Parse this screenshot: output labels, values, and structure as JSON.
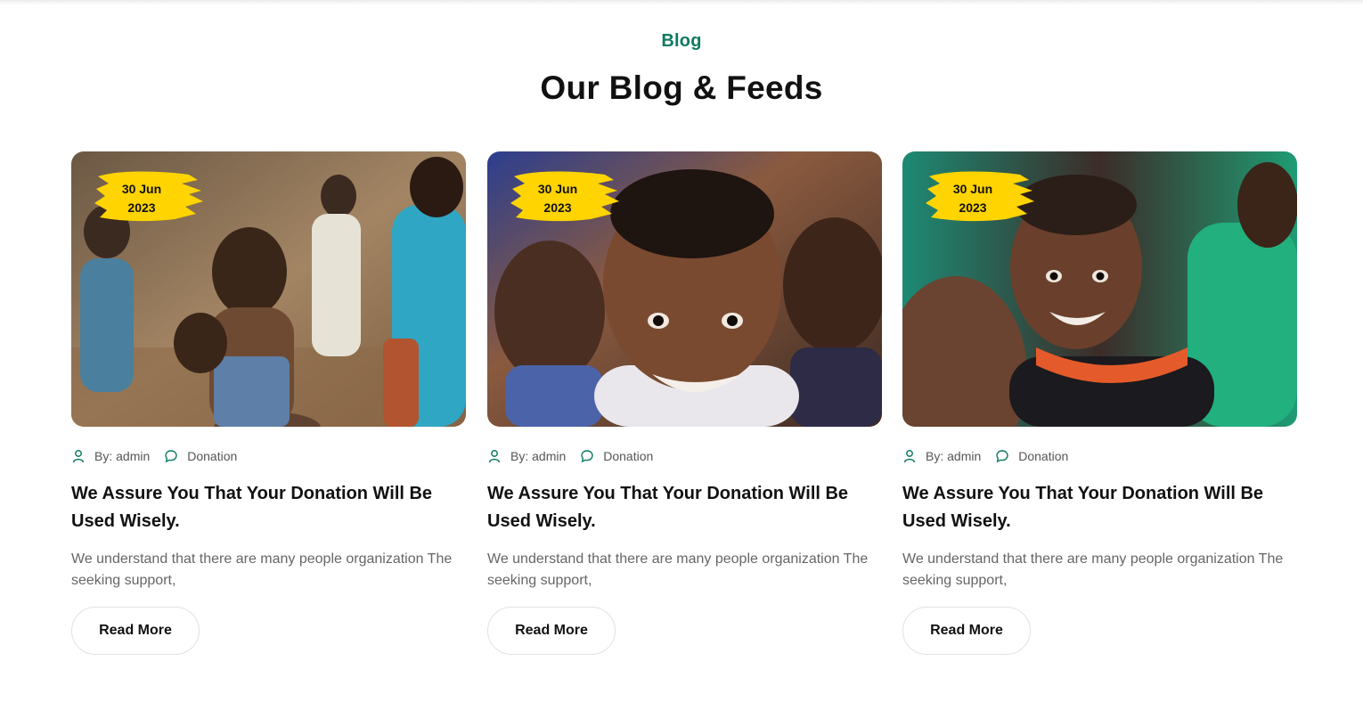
{
  "section": {
    "eyebrow": "Blog",
    "title": "Our Blog & Feeds"
  },
  "colors": {
    "accent": "#0f7a62",
    "badge": "#ffd400"
  },
  "posts": [
    {
      "date_day": "30 Jun",
      "date_year": "2023",
      "author": "By: admin",
      "category": "Donation",
      "title": "We Assure You That Your Donation Will Be Used Wisely.",
      "excerpt": "We understand that there are many people organization The seeking support,",
      "button": "Read More",
      "icons": {
        "author": "user-icon",
        "category": "comment-icon"
      }
    },
    {
      "date_day": "30 Jun",
      "date_year": "2023",
      "author": "By: admin",
      "category": "Donation",
      "title": "We Assure You That Your Donation Will Be Used Wisely.",
      "excerpt": "We understand that there are many people organization The seeking support,",
      "button": "Read More",
      "icons": {
        "author": "user-icon",
        "category": "comment-icon"
      }
    },
    {
      "date_day": "30 Jun",
      "date_year": "2023",
      "author": "By: admin",
      "category": "Donation",
      "title": "We Assure You That Your Donation Will Be Used Wisely.",
      "excerpt": "We understand that there are many people organization The seeking support,",
      "button": "Read More",
      "icons": {
        "author": "user-icon",
        "category": "comment-icon"
      }
    }
  ]
}
